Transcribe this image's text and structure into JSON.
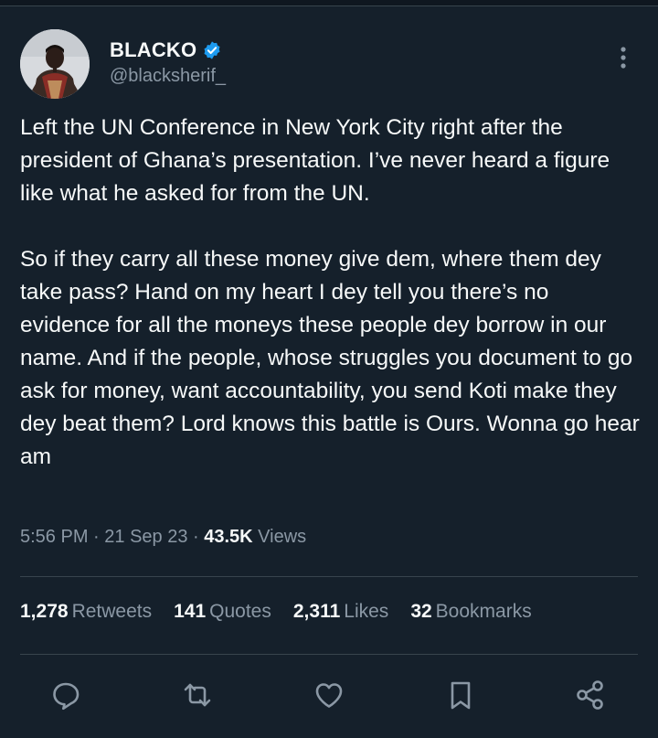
{
  "tweet": {
    "author": {
      "display_name": "BLACKO",
      "handle": "@blacksherif_",
      "verified": true
    },
    "paragraphs": [
      "Left the UN Conference in New York City right after the president of Ghana’s presentation. I’ve never heard a figure like what he asked for from the UN.",
      "So if they carry all these money give dem, where them dey take pass? Hand on my heart I dey tell you there’s no evidence for all the moneys these people dey borrow in our name. And if the people, whose struggles you document to go ask for money, want accountability, you send Koti make they dey beat them? Lord knows this battle is Ours. Wonna go hear am"
    ],
    "meta": {
      "time": "5:56 PM",
      "sep1": " · ",
      "date": "21 Sep 23",
      "sep2": " · ",
      "views_count": "43.5K",
      "views_label": " Views"
    },
    "stats": [
      {
        "count": "1,278",
        "label": "Retweets"
      },
      {
        "count": "141",
        "label": "Quotes"
      },
      {
        "count": "2,311",
        "label": "Likes"
      },
      {
        "count": "32",
        "label": "Bookmarks"
      }
    ]
  },
  "icons": {
    "more": "more-vertical-icon",
    "verified": "verified-badge-icon",
    "reply": "reply-icon",
    "retweet": "retweet-icon",
    "like": "heart-icon",
    "bookmark": "bookmark-icon",
    "share": "share-icon"
  },
  "colors": {
    "background": "#15202b",
    "text_primary": "#f7f9f9",
    "text_secondary": "#8b98a5",
    "divider": "#38444d",
    "verified": "#1d9bf0"
  }
}
